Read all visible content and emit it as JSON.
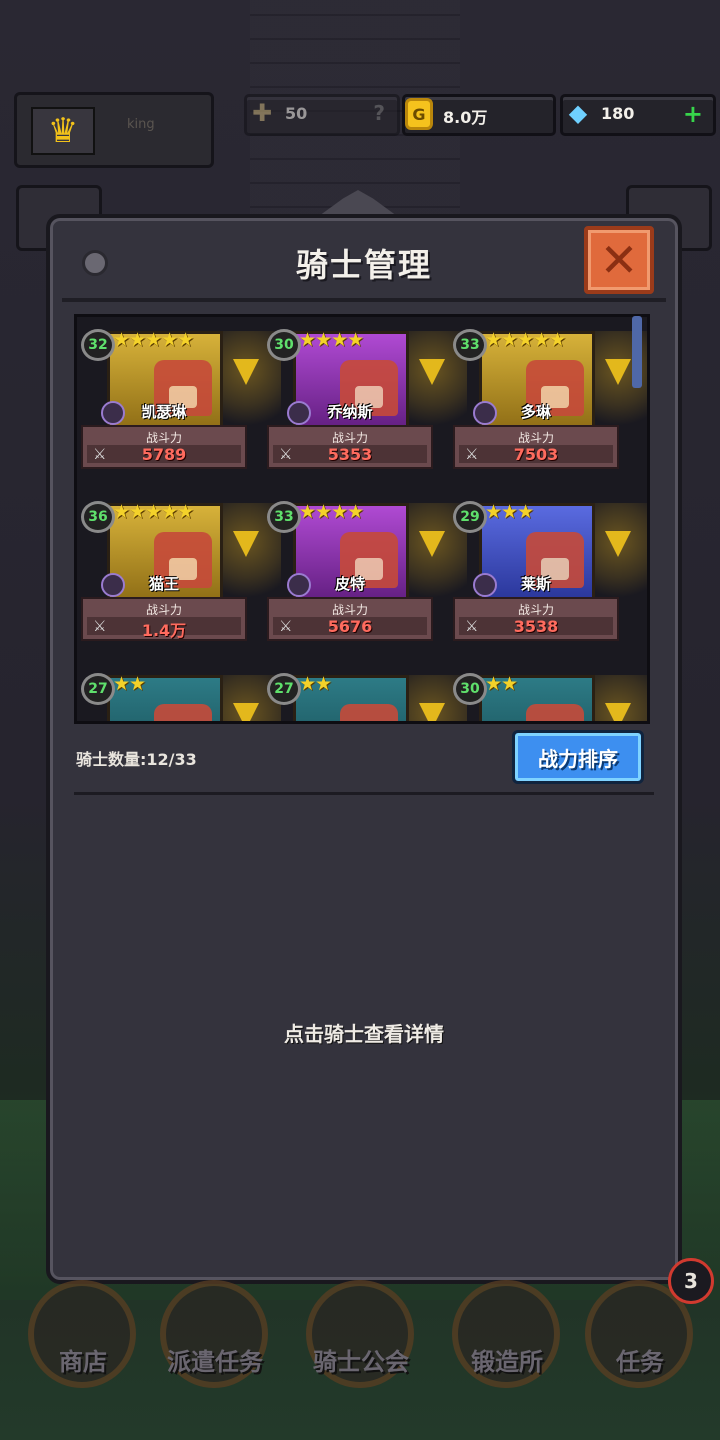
{
  "player": {
    "name": "king"
  },
  "resources": {
    "honor": {
      "value": "50",
      "hint": "?"
    },
    "gold": {
      "value": "8.0万"
    },
    "gem": {
      "value": "180"
    }
  },
  "panel": {
    "title": "骑士管理",
    "knight_count_label": "骑士数量:",
    "knight_count": "12/33",
    "sort_button": "战力排序",
    "hint": "点击骑士查看详情"
  },
  "power_label": "战斗力",
  "knights": [
    {
      "level": "32",
      "stars": "★★★★★",
      "name": "凯瑟琳",
      "power": "5789",
      "quality": "q5"
    },
    {
      "level": "30",
      "stars": "★★★★",
      "name": "乔纳斯",
      "power": "5353",
      "quality": "q4"
    },
    {
      "level": "33",
      "stars": "★★★★★",
      "name": "多琳",
      "power": "7503",
      "quality": "q5"
    },
    {
      "level": "36",
      "stars": "★★★★★",
      "name": "猫王",
      "power": "1.4万",
      "quality": "q5"
    },
    {
      "level": "33",
      "stars": "★★★★",
      "name": "皮特",
      "power": "5676",
      "quality": "q4"
    },
    {
      "level": "29",
      "stars": "★★★",
      "name": "莱斯",
      "power": "3538",
      "quality": "q3"
    },
    {
      "level": "27",
      "stars": "★★",
      "name": "",
      "power": "",
      "quality": "q2"
    },
    {
      "level": "27",
      "stars": "★★",
      "name": "",
      "power": "",
      "quality": "q2"
    },
    {
      "level": "30",
      "stars": "★★",
      "name": "",
      "power": "",
      "quality": "q2"
    }
  ],
  "nav": {
    "shop": "商店",
    "dispatch": "派遣任务",
    "guild": "骑士公会",
    "forge": "锻造所",
    "quest": "任务",
    "quest_badge": "3"
  }
}
